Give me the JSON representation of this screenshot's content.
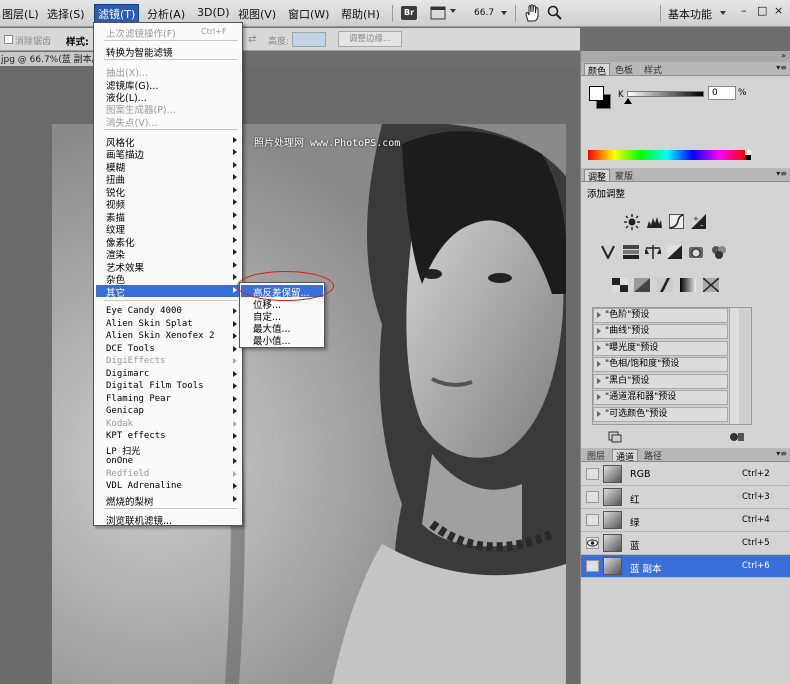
{
  "menubar": {
    "items": [
      "图层(L)",
      "选择(S)",
      "滤镜(T)",
      "分析(A)",
      "3D(D)",
      "视图(V)",
      "窗口(W)",
      "帮助(H)"
    ],
    "br_badge": "Br",
    "zoom": "66.7",
    "workspace": "基本功能",
    "minimize": "–",
    "restore": "□",
    "close": "×"
  },
  "options": {
    "antialias": "消除锯齿",
    "style_label": "样式:",
    "height_label": "高度:",
    "refine_button": "调整边缘..."
  },
  "doc_tab": "jpg @ 66.7%(蓝 副本/",
  "watermark": "照片处理网 www.PhotoPS.com",
  "filter_menu": {
    "last_filter": "上次滤镜操作(F)",
    "last_filter_shortcut": "Ctrl+F",
    "convert_smart": "转换为智能滤镜",
    "extract": "抽出(X)...",
    "gallery": "滤镜库(G)...",
    "liquify": "液化(L)...",
    "pattern_maker": "图案生成器(P)...",
    "vanishing_point": "消失点(V)...",
    "groups": [
      "风格化",
      "画笔描边",
      "模糊",
      "扭曲",
      "锐化",
      "视频",
      "素描",
      "纹理",
      "像素化",
      "渲染",
      "艺术效果",
      "杂色",
      "其它"
    ],
    "plugins": [
      "Eye Candy 4000",
      "Alien Skin Splat",
      "Alien Skin Xenofex 2",
      "DCE Tools",
      "DigiEffects",
      "Digimarc",
      "Digital Film Tools",
      "Flaming Pear",
      "Genicap",
      "Kodak",
      "KPT effects",
      "LP 扫光",
      "onOne",
      "Redfield",
      "VDL Adrenaline",
      "燃烧的梨树"
    ],
    "browse_online": "浏览联机滤镜..."
  },
  "submenu": {
    "items": [
      "高反差保留...",
      "位移...",
      "自定...",
      "最大值...",
      "最小值..."
    ]
  },
  "color_panel": {
    "tabs": [
      "颜色",
      "色板",
      "样式"
    ],
    "slider_label": "K",
    "value": "0",
    "unit": "%"
  },
  "adjust_panel": {
    "tabs": [
      "调整",
      "蒙版"
    ],
    "title": "添加调整",
    "presets": [
      "\"色阶\"预设",
      "\"曲线\"预设",
      "\"曝光度\"预设",
      "\"色相/饱和度\"预设",
      "\"黑白\"预设",
      "\"通道混和器\"预设",
      "\"可选颜色\"预设"
    ]
  },
  "channels_panel": {
    "tabs": [
      "图层",
      "通道",
      "路径"
    ],
    "channels": [
      {
        "name": "RGB",
        "shortcut": "Ctrl+2"
      },
      {
        "name": "红",
        "shortcut": "Ctrl+3"
      },
      {
        "name": "绿",
        "shortcut": "Ctrl+4"
      },
      {
        "name": "蓝",
        "shortcut": "Ctrl+5"
      },
      {
        "name": "蓝 副本",
        "shortcut": "Ctrl+6"
      }
    ]
  },
  "colors": {
    "highlight": "#3a6fd8",
    "menu_active": "#2a5db0",
    "annotation": "#e01818"
  }
}
